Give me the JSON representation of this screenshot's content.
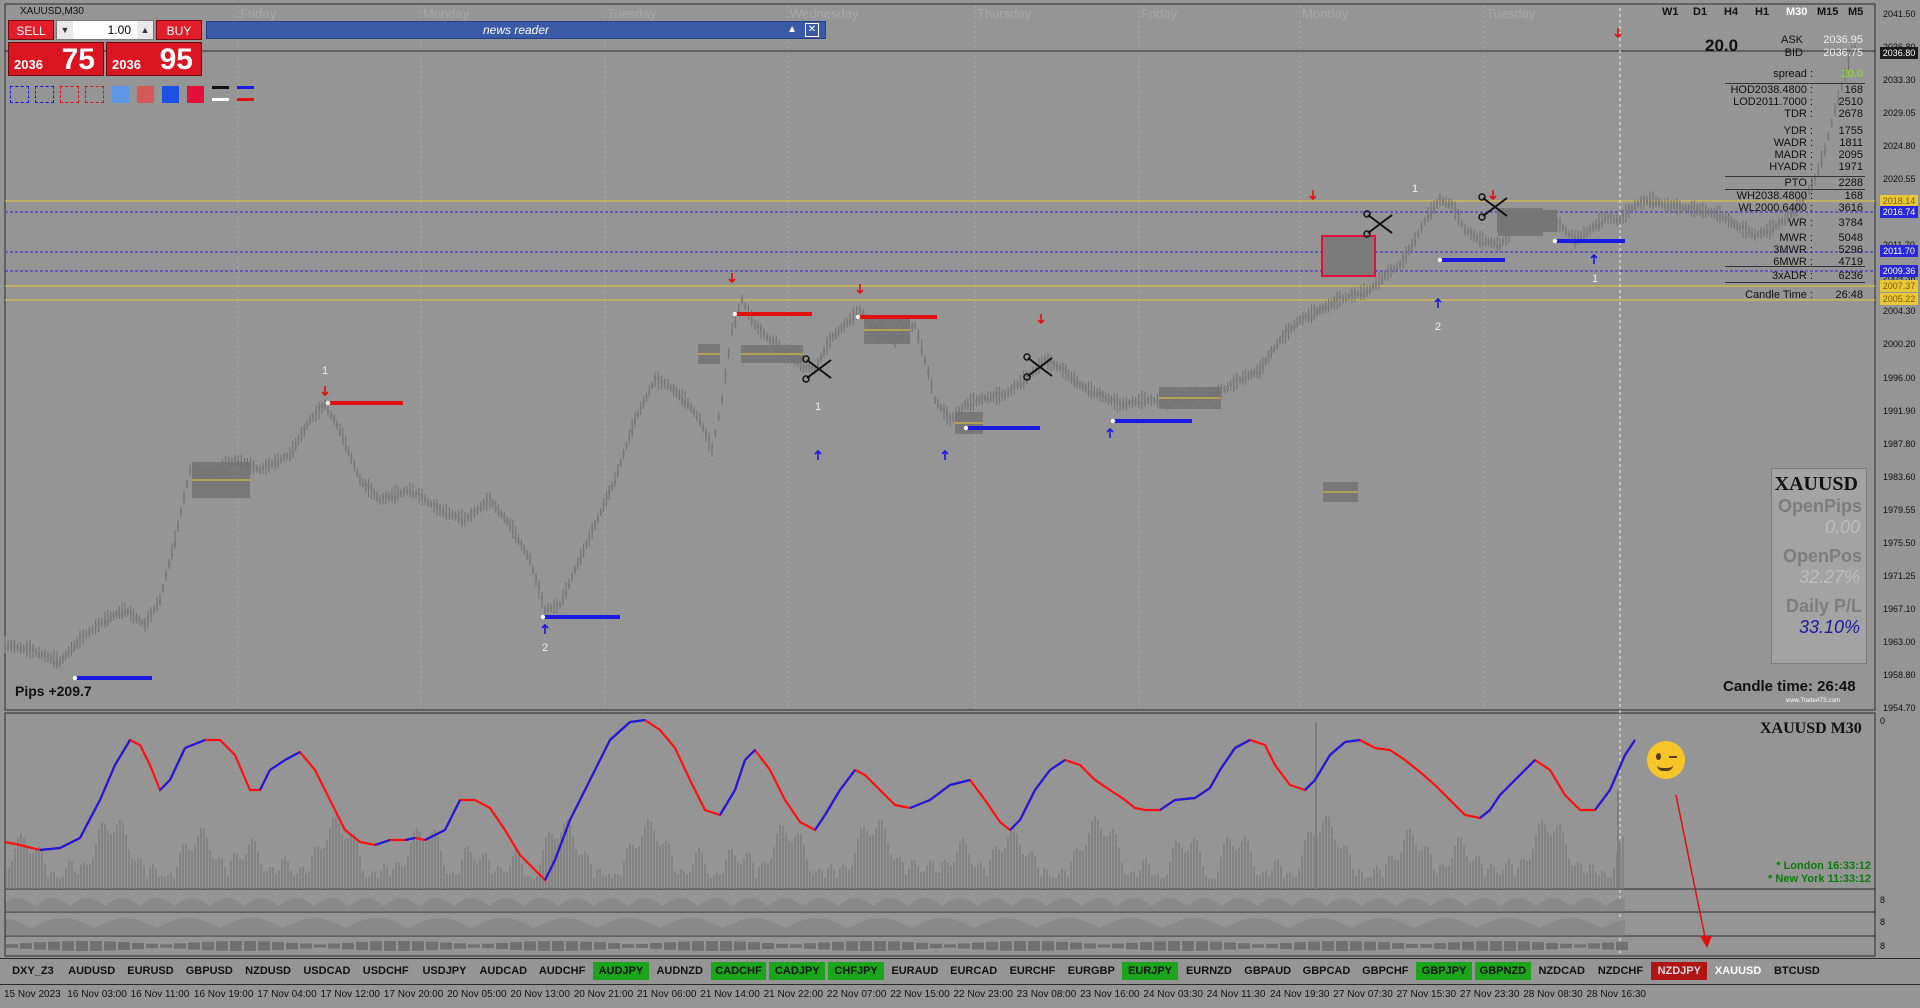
{
  "window": {
    "title": "XAUUSD,M30",
    "news_title": "news reader",
    "symbol_big": "20.0"
  },
  "trade_panel": {
    "sell_label": "SELL",
    "buy_label": "BUY",
    "lot": "1.00",
    "sell_small": "2036",
    "sell_big": "75",
    "buy_small": "2036",
    "buy_big": "95"
  },
  "timeframes": [
    {
      "label": "W1"
    },
    {
      "label": "D1"
    },
    {
      "label": "H4"
    },
    {
      "label": "H1"
    },
    {
      "label": "M30",
      "active": true
    },
    {
      "label": "M15"
    },
    {
      "label": "M5"
    }
  ],
  "day_labels": [
    "Friday",
    "Monday",
    "Tuesday",
    "Wednesday",
    "Thursday",
    "Friday",
    "Monday",
    "Tuesday"
  ],
  "info_panel": [
    {
      "label": "ASK",
      "value": "2036.95"
    },
    {
      "label": "BID",
      "value": "2036.75"
    },
    {
      "label": "spread :",
      "value": "20.0"
    },
    {
      "label": "HOD2038.4800 :",
      "value": "168"
    },
    {
      "label": "LOD2011.7000 :",
      "value": "2510"
    },
    {
      "label": "TDR :",
      "value": "2678"
    },
    {
      "label": "YDR :",
      "value": "1755"
    },
    {
      "label": "WADR :",
      "value": "1811"
    },
    {
      "label": "MADR :",
      "value": "2095"
    },
    {
      "label": "HYADR :",
      "value": "1971"
    },
    {
      "label": "PTO :",
      "value": "2288"
    },
    {
      "label": "WH2038.4800 :",
      "value": "168"
    },
    {
      "label": "WL2000.6400 :",
      "value": "3616"
    },
    {
      "label": "WR :",
      "value": "3784"
    },
    {
      "label": "MWR :",
      "value": "5048"
    },
    {
      "label": "3MWR :",
      "value": "5296"
    },
    {
      "label": "6MWR :",
      "value": "4719"
    },
    {
      "label": "3xADR :",
      "value": "6236"
    },
    {
      "label": "Candle Time :",
      "value": "26:48"
    }
  ],
  "price_axis": [
    "2041.50",
    "2036.80",
    "2033.30",
    "2029.05",
    "2024.80",
    "2020.55",
    "2016.74",
    "2011.70",
    "2009.36",
    "2004.30",
    "2000.20",
    "1996.00",
    "1991.90",
    "1987.80",
    "1983.60",
    "1979.55",
    "1975.50",
    "1971.25",
    "1967.10",
    "1963.00",
    "1958.80",
    "1954.70"
  ],
  "price_tags": [
    {
      "label": "2036.80",
      "color": "#1b1b1b",
      "text": "#ffffff"
    },
    {
      "label": "2018.14",
      "color": "#e8c838",
      "text": "#7a5a00"
    },
    {
      "label": "2016.74",
      "color": "#2828d8",
      "text": "#ffffff"
    },
    {
      "label": "2011.70",
      "color": "#2828d8",
      "text": "#ffffff"
    },
    {
      "label": "2009.36",
      "color": "#2828d8",
      "text": "#ffffff"
    },
    {
      "label": "2007.37",
      "color": "#e8c838",
      "text": "#7a5a00"
    },
    {
      "label": "2005.22",
      "color": "#e8c838",
      "text": "#7a5a00"
    }
  ],
  "stats": {
    "symbol": "XAUUSD",
    "open_pips_label": "OpenPips",
    "open_pips": "0.00",
    "open_pos_label": "OpenPos",
    "open_pos": "32.27%",
    "daily_pl_label": "Daily P/L",
    "daily_pl": "33.10%",
    "watermark": "www.TradeATS.com"
  },
  "candle_time": "Candle time:  26:48",
  "pips_label": "Pips +209.7",
  "sub_title": "XAUUSD  M30",
  "sessions": [
    {
      "label": "* London",
      "time": "16:33:12"
    },
    {
      "label": "* New York",
      "time": "11:33:12"
    }
  ],
  "zigzag_labels": [
    "1",
    "2",
    "1",
    "1",
    "2",
    "1"
  ],
  "symbols": [
    {
      "label": "DXY_Z3",
      "style": "plain"
    },
    {
      "label": "AUDUSD",
      "style": "plain"
    },
    {
      "label": "EURUSD",
      "style": "plain"
    },
    {
      "label": "GBPUSD",
      "style": "plain"
    },
    {
      "label": "NZDUSD",
      "style": "plain"
    },
    {
      "label": "USDCAD",
      "style": "plain"
    },
    {
      "label": "USDCHF",
      "style": "plain"
    },
    {
      "label": "USDJPY",
      "style": "plain"
    },
    {
      "label": "AUDCAD",
      "style": "plain"
    },
    {
      "label": "AUDCHF",
      "style": "plain"
    },
    {
      "label": "AUDJPY",
      "style": "green"
    },
    {
      "label": "AUDNZD",
      "style": "plain"
    },
    {
      "label": "CADCHF",
      "style": "green"
    },
    {
      "label": "CADJPY",
      "style": "green"
    },
    {
      "label": "CHFJPY",
      "style": "green"
    },
    {
      "label": "EURAUD",
      "style": "plain"
    },
    {
      "label": "EURCAD",
      "style": "plain"
    },
    {
      "label": "EURCHF",
      "style": "plain"
    },
    {
      "label": "EURGBP",
      "style": "plain"
    },
    {
      "label": "EURJPY",
      "style": "green"
    },
    {
      "label": "EURNZD",
      "style": "plain"
    },
    {
      "label": "GBPAUD",
      "style": "plain"
    },
    {
      "label": "GBPCAD",
      "style": "plain"
    },
    {
      "label": "GBPCHF",
      "style": "plain"
    },
    {
      "label": "GBPJPY",
      "style": "green"
    },
    {
      "label": "GBPNZD",
      "style": "green"
    },
    {
      "label": "NZDCAD",
      "style": "plain"
    },
    {
      "label": "NZDCHF",
      "style": "plain"
    },
    {
      "label": "NZDJPY",
      "style": "red"
    },
    {
      "label": "XAUUSD",
      "style": "white"
    },
    {
      "label": "BTCUSD",
      "style": "plain"
    }
  ],
  "time_axis": [
    "15 Nov 2023",
    "16 Nov 03:00",
    "16 Nov 11:00",
    "16 Nov 19:00",
    "17 Nov 04:00",
    "17 Nov 12:00",
    "17 Nov 20:00",
    "20 Nov 05:00",
    "20 Nov 13:00",
    "20 Nov 21:00",
    "21 Nov 06:00",
    "21 Nov 14:00",
    "21 Nov 22:00",
    "22 Nov 07:00",
    "22 Nov 15:00",
    "22 Nov 23:00",
    "23 Nov 08:00",
    "23 Nov 16:00",
    "24 Nov 03:30",
    "24 Nov 11:30",
    "24 Nov 19:30",
    "27 Nov 07:30",
    "27 Nov 15:30",
    "27 Nov 23:30",
    "28 Nov 08:30",
    "28 Nov 16:30"
  ],
  "sub_axis": [
    "0",
    "8",
    "8",
    "8"
  ],
  "colors": {
    "background": "#959595",
    "bull_line": "#ff1010",
    "bear_line": "#1a1ae0",
    "support": "#0a0adf",
    "resistance": "#e01010",
    "yellow": "#e8c838"
  }
}
